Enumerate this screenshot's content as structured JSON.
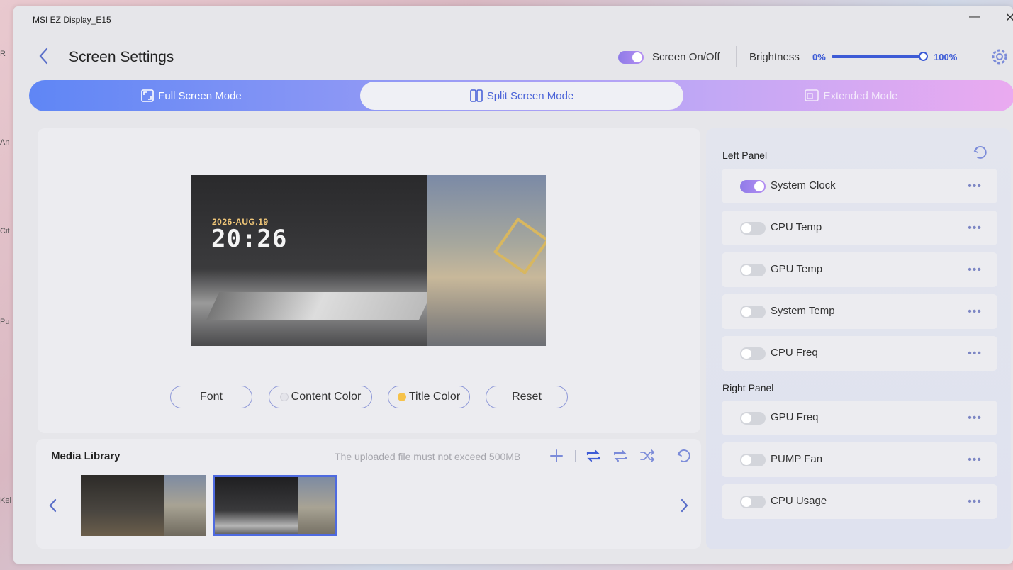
{
  "window": {
    "title": "MSI EZ Display_E15"
  },
  "header": {
    "title": "Screen Settings",
    "screen_toggle_label": "Screen On/Off",
    "screen_on": true,
    "brightness_label": "Brightness",
    "brightness_min": "0%",
    "brightness_max": "100%",
    "brightness_value": 1.0
  },
  "modes": [
    {
      "label": "Full Screen Mode",
      "icon": "fullscreen-icon"
    },
    {
      "label": "Split Screen Mode",
      "icon": "split-icon",
      "active": true
    },
    {
      "label": "Extended Mode",
      "icon": "extended-icon"
    }
  ],
  "preview": {
    "date": "2026-AUG.19",
    "time": "20:26"
  },
  "tools": {
    "font": "Font",
    "content_color": "Content Color",
    "title_color": "Title Color",
    "reset": "Reset"
  },
  "media": {
    "title": "Media Library",
    "hint": "The uploaded file must not exceed 500MB"
  },
  "side": {
    "left_panel_label": "Left Panel",
    "right_panel_label": "Right Panel",
    "left_items": [
      {
        "label": "System Clock",
        "on": true
      },
      {
        "label": "CPU Temp",
        "on": false
      },
      {
        "label": "GPU Temp",
        "on": false
      },
      {
        "label": "System Temp",
        "on": false
      },
      {
        "label": "CPU Freq",
        "on": false
      }
    ],
    "right_items": [
      {
        "label": "GPU Freq",
        "on": false
      },
      {
        "label": "PUMP Fan",
        "on": false
      },
      {
        "label": "CPU Usage",
        "on": false
      }
    ],
    "more_glyph": "•••"
  },
  "colors": {
    "accent": "#3d5bd6",
    "toggle_on": "#9b82ec",
    "title_color_dot": "#f6c24a"
  }
}
